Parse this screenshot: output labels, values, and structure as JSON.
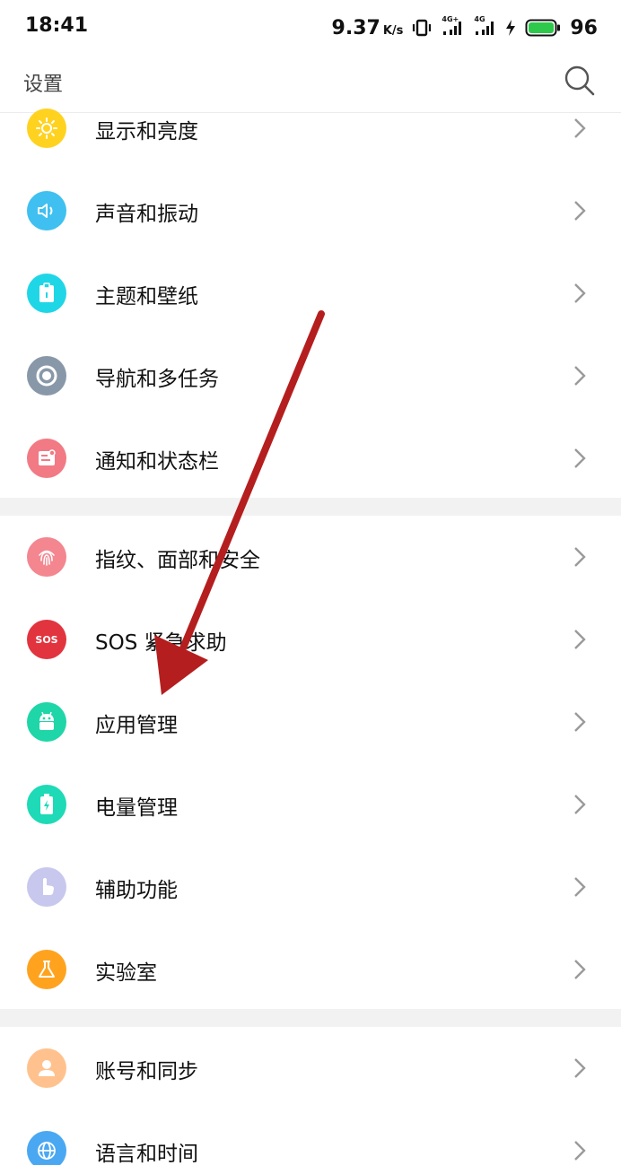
{
  "status": {
    "time": "18:41",
    "speed": "9.37",
    "speed_unit": "K/s",
    "battery": "96",
    "network1": "4G+",
    "network2": "4G"
  },
  "header": {
    "title": "设置"
  },
  "items": [
    {
      "label": "显示和亮度",
      "icon": "sun-icon",
      "color": "#FFD21F"
    },
    {
      "label": "声音和振动",
      "icon": "speaker-icon",
      "color": "#3FC0F0"
    },
    {
      "label": "主题和壁纸",
      "icon": "theme-icon",
      "color": "#1FD6E6"
    },
    {
      "label": "导航和多任务",
      "icon": "navigation-icon",
      "color": "#8898A8"
    },
    {
      "label": "通知和状态栏",
      "icon": "notification-icon",
      "color": "#F27A84"
    },
    {
      "label": "指纹、面部和安全",
      "icon": "fingerprint-icon",
      "color": "#F3868F"
    },
    {
      "label": "SOS 紧急求助",
      "icon": "sos-icon",
      "color": "#E2343F",
      "icon_text": "SOS"
    },
    {
      "label": "应用管理",
      "icon": "android-icon",
      "color": "#1ED6A8"
    },
    {
      "label": "电量管理",
      "icon": "battery-icon",
      "color": "#1EDAB6"
    },
    {
      "label": "辅助功能",
      "icon": "hand-icon",
      "color": "#C8C8EE"
    },
    {
      "label": "实验室",
      "icon": "flask-icon",
      "color": "#FFA31F"
    },
    {
      "label": "账号和同步",
      "icon": "account-icon",
      "color": "#FFC28E"
    },
    {
      "label": "语言和时间",
      "icon": "globe-icon",
      "color": "#4AA8F2"
    }
  ]
}
